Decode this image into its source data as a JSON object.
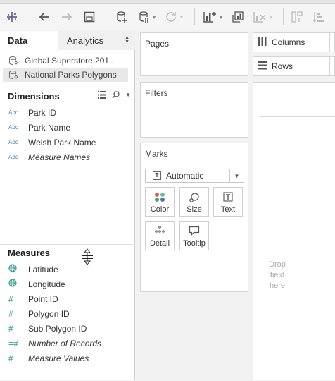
{
  "toolbar": {
    "items": [
      "tableau-icon",
      "undo-icon",
      "redo-icon",
      "save-icon",
      "new-datasource-icon",
      "pause-updates-icon",
      "refresh-icon",
      "new-worksheet-icon",
      "duplicate-sheet-icon",
      "clear-sheet-icon",
      "swap-icon",
      "sort-icon"
    ]
  },
  "datapane": {
    "tabs": {
      "data": "Data",
      "analytics": "Analytics"
    },
    "sources": [
      {
        "label": "Global Superstore 201...",
        "selected": false
      },
      {
        "label": "National Parks Polygons",
        "selected": true
      }
    ],
    "dimensions": {
      "heading": "Dimensions",
      "fields": [
        {
          "icon": "Abc",
          "label": "Park ID"
        },
        {
          "icon": "Abc",
          "label": "Park Name"
        },
        {
          "icon": "Abc",
          "label": "Welsh Park Name"
        },
        {
          "icon": "Abc",
          "label": "Measure Names"
        }
      ]
    },
    "measures": {
      "heading": "Measures",
      "fields": [
        {
          "icon": "globe-icon",
          "label": "Latitude"
        },
        {
          "icon": "globe-icon",
          "label": "Longitude"
        },
        {
          "icon": "#",
          "label": "Point ID"
        },
        {
          "icon": "#",
          "label": "Polygon ID"
        },
        {
          "icon": "#",
          "label": "Sub Polygon ID"
        },
        {
          "icon": "=#",
          "label": "Number of Records"
        },
        {
          "icon": "#",
          "label": "Measure Values"
        }
      ]
    }
  },
  "cards": {
    "pages": "Pages",
    "filters": "Filters",
    "marks": {
      "title": "Marks",
      "type": "Automatic",
      "buttons": {
        "color": "Color",
        "size": "Size",
        "text": "Text",
        "detail": "Detail",
        "tooltip": "Tooltip"
      }
    }
  },
  "view": {
    "columns": "Columns",
    "rows": "Rows",
    "drop_hint": "Drop field here"
  },
  "colors": {
    "dimension": "#4b86b4",
    "measure": "#2a9d8f"
  }
}
